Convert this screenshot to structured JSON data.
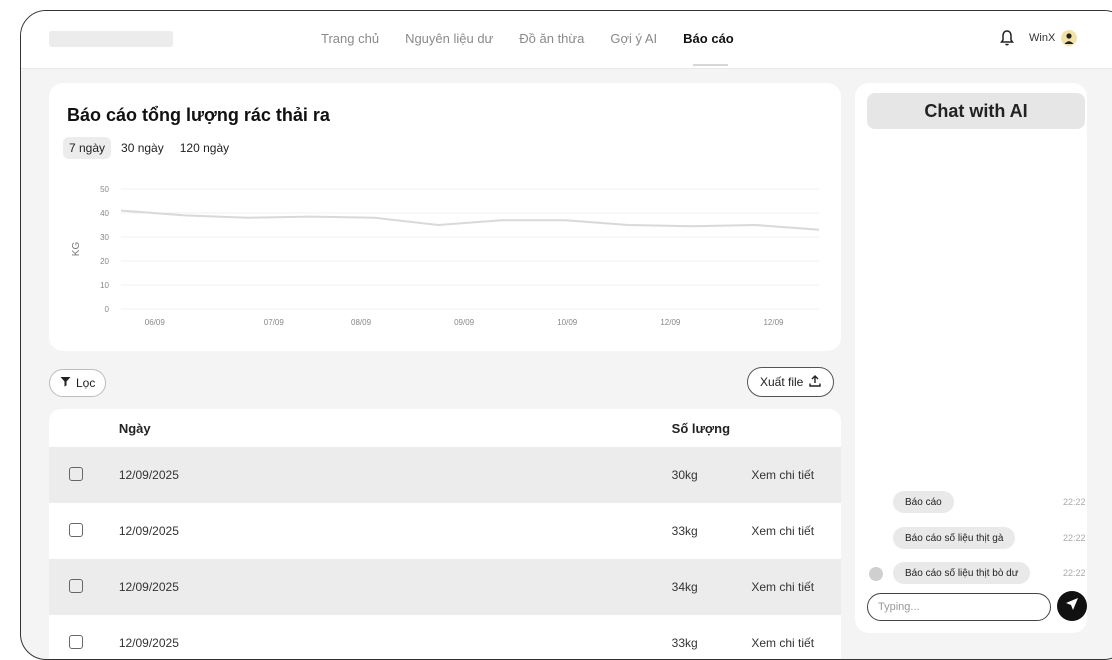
{
  "header": {
    "nav": [
      {
        "label": "Trang chủ"
      },
      {
        "label": "Nguyên liệu dư"
      },
      {
        "label": "Đồ ăn thừa"
      },
      {
        "label": "Gợi ý AI"
      },
      {
        "label": "Báo cáo"
      }
    ],
    "active_nav": "Báo cáo",
    "username": "WinX"
  },
  "report": {
    "title": "Báo cáo tổng lượng rác thải ra",
    "ranges": [
      "7 ngày",
      "30 ngày",
      "120 ngày"
    ],
    "active_range": "7 ngày",
    "filter_label": "Lọc",
    "export_label": "Xuất file"
  },
  "chart_data": {
    "type": "line",
    "title": "",
    "ylabel": "KG",
    "xlabel": "",
    "ylim": [
      0,
      50
    ],
    "yticks": [
      0,
      10,
      20,
      30,
      40,
      50
    ],
    "categories": [
      "06/09",
      "07/09",
      "08/09",
      "09/09",
      "10/09",
      "12/09",
      "12/09"
    ],
    "x_positions": [
      0.3,
      1.8,
      2.9,
      4.2,
      5.5,
      6.8,
      8.1
    ],
    "series": [
      {
        "points_x": [
          0,
          0.8,
          1.6,
          2.4,
          3.2,
          4.0,
          4.8,
          5.6,
          6.4,
          7.2,
          8.0,
          8.8
        ],
        "points_y": [
          41,
          39,
          38,
          38.5,
          38,
          35,
          37,
          37,
          35,
          34.5,
          35,
          33
        ]
      }
    ],
    "grid": true,
    "color": "#d9d9d9"
  },
  "table": {
    "headers": {
      "date": "Ngày",
      "qty": "Số lượng"
    },
    "rows": [
      {
        "date": "12/09/2025",
        "qty": "30kg",
        "detail": "Xem chi tiết"
      },
      {
        "date": "12/09/2025",
        "qty": "33kg",
        "detail": "Xem chi tiết"
      },
      {
        "date": "12/09/2025",
        "qty": "34kg",
        "detail": "Xem chi tiết"
      },
      {
        "date": "12/09/2025",
        "qty": "33kg",
        "detail": "Xem chi tiết"
      }
    ]
  },
  "chat": {
    "title": "Chat with AI",
    "messages": [
      {
        "text": "Báo cáo",
        "time": "22:22"
      },
      {
        "text": "Báo cáo số liệu thịt gà",
        "time": "22:22"
      },
      {
        "text": "Báo cáo số liệu thịt bò dư",
        "time": "22:22"
      }
    ],
    "input_placeholder": "Typing..."
  },
  "icons": {
    "bell": "bell-icon",
    "filter": "filter-icon",
    "export": "upload-icon",
    "send": "send-icon",
    "avatar": "avatar-icon"
  }
}
